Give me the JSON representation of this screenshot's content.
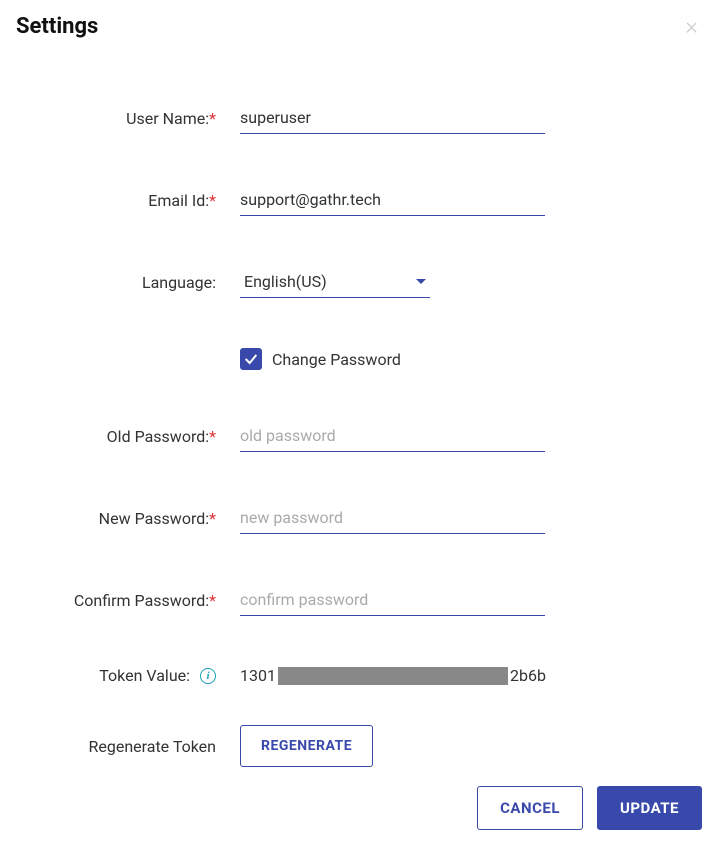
{
  "header": {
    "title": "Settings"
  },
  "form": {
    "userName": {
      "label": "User Name:",
      "value": "superuser",
      "required": true
    },
    "emailId": {
      "label": "Email Id:",
      "value": "support@gathr.tech",
      "required": true
    },
    "language": {
      "label": "Language:",
      "value": "English(US)"
    },
    "changePassword": {
      "label": "Change Password",
      "checked": true
    },
    "oldPassword": {
      "label": "Old Password:",
      "placeholder": "old password",
      "required": true
    },
    "newPassword": {
      "label": "New Password:",
      "placeholder": "new password",
      "required": true
    },
    "confirmPassword": {
      "label": "Confirm Password:",
      "placeholder": "confirm password",
      "required": true
    },
    "tokenValue": {
      "label": "Token Value:",
      "prefix": "1301",
      "suffix": "2b6b"
    },
    "regenerate": {
      "label": "Regenerate Token",
      "button": "REGENERATE"
    }
  },
  "footer": {
    "cancel": "CANCEL",
    "update": "UPDATE"
  }
}
